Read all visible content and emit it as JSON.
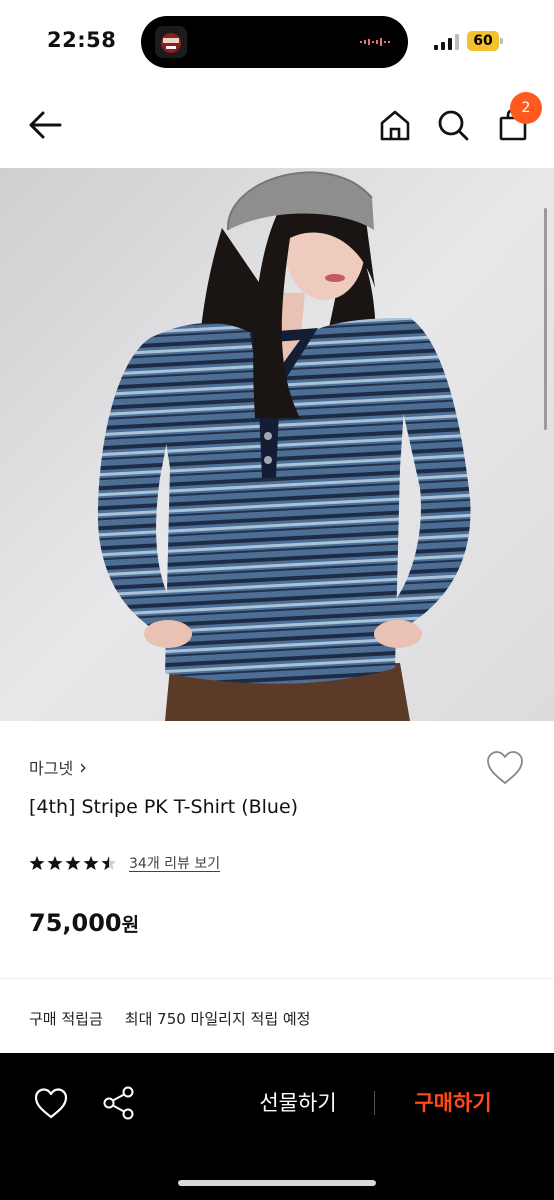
{
  "status_bar": {
    "time": "22:58",
    "battery": "60"
  },
  "header": {
    "cart_count": "2"
  },
  "product": {
    "brand": "마그넷",
    "brand_chevron": "›",
    "title": "[4th] Stripe PK T-Shirt (Blue)",
    "rating": 4.5,
    "review_link": "34개 리뷰 보기",
    "price": "75,000",
    "price_unit": "원"
  },
  "points": {
    "label": "구매 적립금",
    "value": "최대 750 마일리지 적립 예정"
  },
  "bottom_bar": {
    "gift_label": "선물하기",
    "buy_label": "구매하기"
  },
  "colors": {
    "accent": "#ff4b17",
    "badge": "#ff5a1f",
    "bottom_bar_bg": "#000000"
  }
}
